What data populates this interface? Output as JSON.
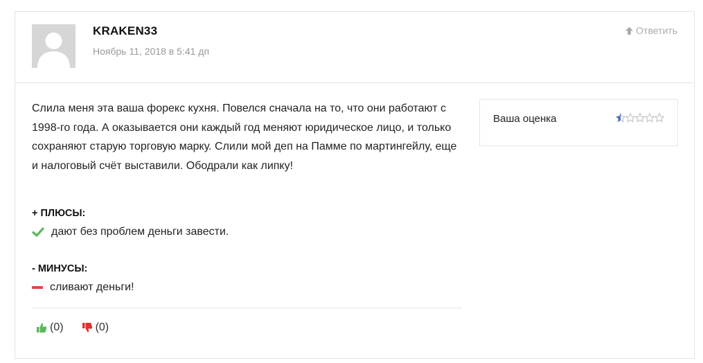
{
  "review": {
    "author": "KRAKEN33",
    "date": "Ноябрь 11, 2018 в 5:41 дп",
    "reply_label": "Ответить",
    "text": "Слила меня эта ваша форекс кухня. Повелся сначала на то, что они работают с 1998-го года. А оказывается они каждый год меняют юридическое лицо, и только сохраняют старую торговую марку. Слили мой деп на Памме по мартингейлу, еще и налоговый счёт выставили. Ободрали как липку!"
  },
  "pros": {
    "title": "+ ПЛЮСЫ:",
    "items": [
      "дают без проблем деньги завести."
    ]
  },
  "cons": {
    "title": "- МИНУСЫ:",
    "items": [
      "сливают деньги!"
    ]
  },
  "votes": {
    "up": "(0)",
    "down": "(0)"
  },
  "rating": {
    "label": "Ваша оценка",
    "value": 0.5,
    "max": 5
  },
  "colors": {
    "accent_green": "#5cb85c",
    "accent_red": "#e04848",
    "star_blue": "#3a6fbf"
  },
  "icons": {
    "reply": "arrow-up-icon",
    "pro": "check-icon",
    "con": "dash-icon",
    "vote_up": "thumbs-up-icon",
    "vote_down": "thumbs-down-icon",
    "avatar": "user-silhouette-icon"
  }
}
